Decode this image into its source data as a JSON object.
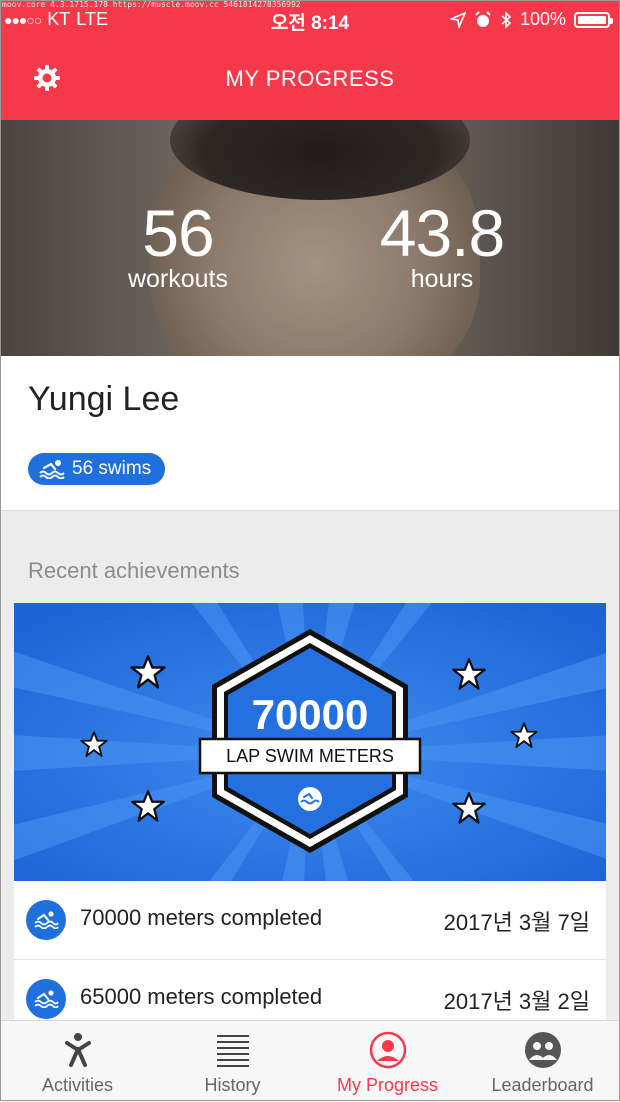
{
  "status_bar": {
    "debug_url": "moov.core 4.3.1715.178 https://muscle.moov.cc 5461814278356992",
    "carrier": "KT",
    "network": "LTE",
    "time": "오전 8:14",
    "battery": "100%"
  },
  "header": {
    "title": "MY PROGRESS",
    "settings_icon": "gear-icon"
  },
  "stats": {
    "workouts_value": "56",
    "workouts_label": "workouts",
    "hours_value": "43.8",
    "hours_label": "hours"
  },
  "profile": {
    "name": "Yungi Lee",
    "swims_badge": "56 swims"
  },
  "achievements": {
    "section_title": "Recent achievements",
    "badge": {
      "value": "70000",
      "label": "LAP SWIM METERS"
    },
    "items": [
      {
        "text": "70000 meters completed",
        "date": "2017년 3월 7일"
      },
      {
        "text": "65000 meters completed",
        "date": "2017년 3월 2일"
      }
    ]
  },
  "tabs": [
    {
      "label": "Activities",
      "icon": "person-icon"
    },
    {
      "label": "History",
      "icon": "list-icon"
    },
    {
      "label": "My Progress",
      "icon": "avatar-icon",
      "active": true
    },
    {
      "label": "Leaderboard",
      "icon": "group-icon"
    }
  ],
  "colors": {
    "accent": "#f5394b",
    "swim_blue": "#1f6fdc"
  }
}
